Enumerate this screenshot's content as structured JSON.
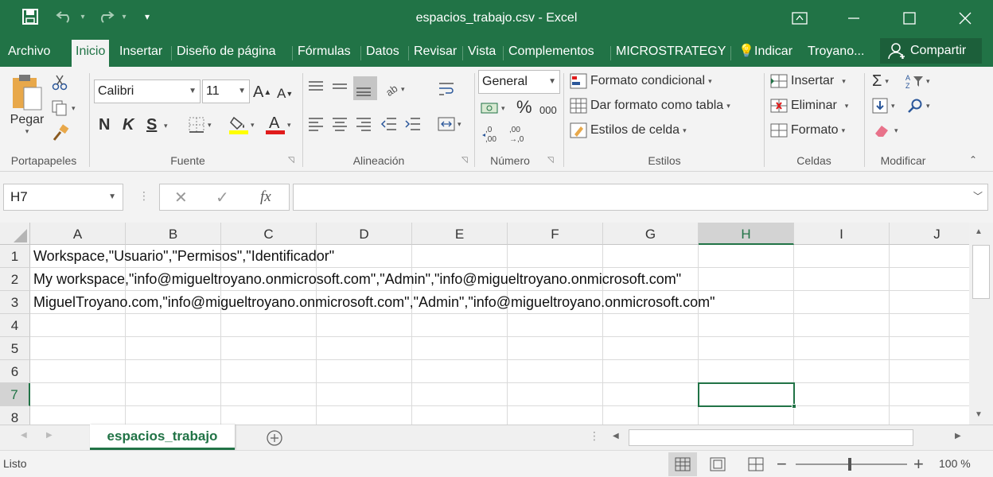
{
  "title": "espacios_trabajo.csv - Excel",
  "menu": {
    "archivo": "Archivo",
    "inicio": "Inicio",
    "insertar": "Insertar",
    "diseno": "Diseño de página",
    "formulas": "Fórmulas",
    "datos": "Datos",
    "revisar": "Revisar",
    "vista": "Vista",
    "complementos": "Complementos",
    "microstrategy": "MICROSTRATEGY",
    "indicar": "Indicar",
    "user": "Troyano...",
    "share": "Compartir"
  },
  "ribbon": {
    "clipboard": {
      "paste": "Pegar",
      "label": "Portapapeles"
    },
    "font": {
      "name": "Calibri",
      "size": "11",
      "bold": "N",
      "italic": "K",
      "underline": "S",
      "label": "Fuente"
    },
    "alignment": {
      "label": "Alineación"
    },
    "number": {
      "format": "General",
      "percent": "%",
      "thousands": "000",
      "inc": ",0\n,00",
      "label": "Número"
    },
    "styles": {
      "conditional": "Formato condicional",
      "table": "Dar formato como tabla",
      "cell": "Estilos de celda",
      "label": "Estilos"
    },
    "cells": {
      "insert": "Insertar",
      "delete": "Eliminar",
      "format": "Formato",
      "label": "Celdas"
    },
    "editing": {
      "label": "Modificar"
    }
  },
  "namebox": "H7",
  "fx": "fx",
  "columns": [
    "A",
    "B",
    "C",
    "D",
    "E",
    "F",
    "G",
    "H",
    "I",
    "J"
  ],
  "rows": [
    "1",
    "2",
    "3",
    "4",
    "5",
    "6",
    "7",
    "8"
  ],
  "cells": [
    "Workspace,\"Usuario\",\"Permisos\",\"Identificador\"",
    "My workspace,\"info@migueltroyano.onmicrosoft.com\",\"Admin\",\"info@migueltroyano.onmicrosoft.com\"",
    "MiguelTroyano.com,\"info@migueltroyano.onmicrosoft.com\",\"Admin\",\"info@migueltroyano.onmicrosoft.com\""
  ],
  "sheet": "espacios_trabajo",
  "status": "Listo",
  "zoom": "100 %",
  "colors": {
    "accent": "#217346"
  }
}
